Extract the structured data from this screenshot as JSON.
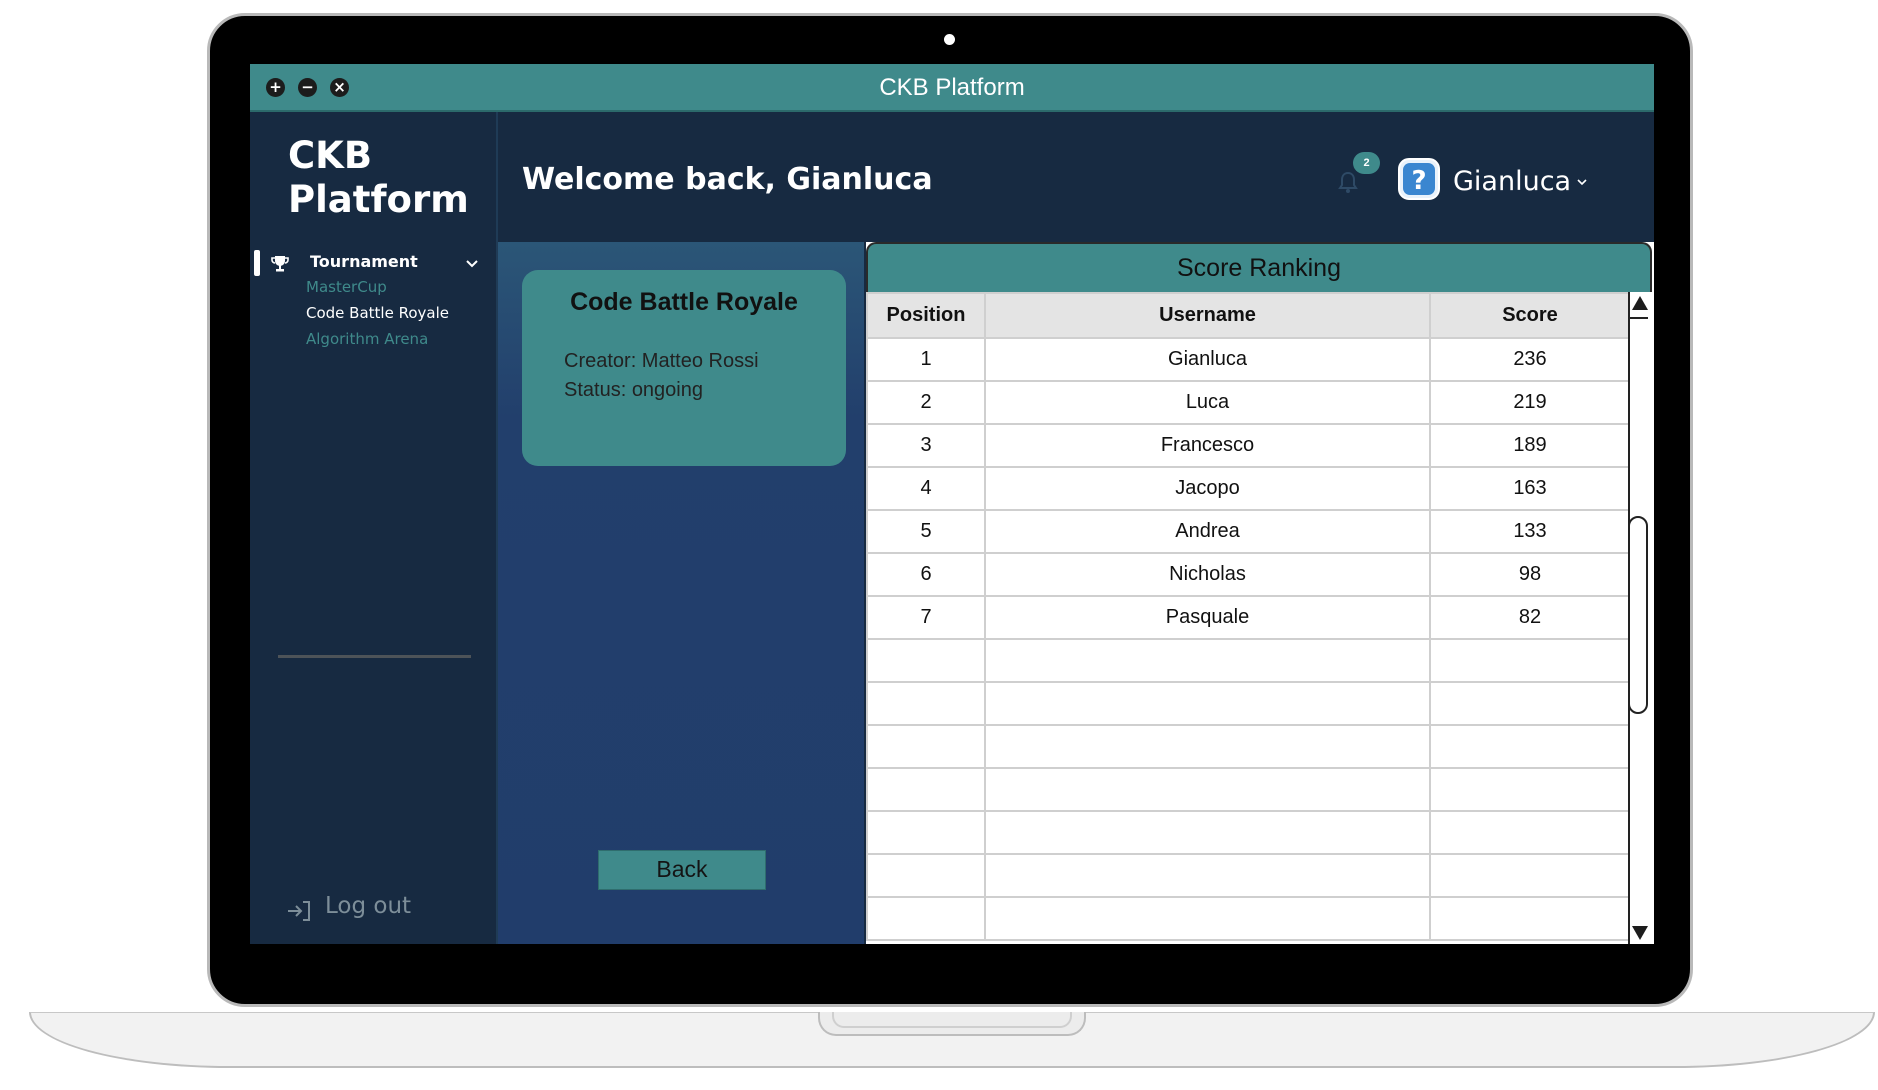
{
  "window": {
    "title": "CKB Platform",
    "buttons": [
      "+",
      "−",
      "×"
    ]
  },
  "sidebar": {
    "brand_line1": "CKB",
    "brand_line2": "Platform",
    "section_label": "Tournament",
    "items": [
      {
        "label": "MasterCup",
        "active": false
      },
      {
        "label": "Code Battle Royale",
        "active": true
      },
      {
        "label": "Algorithm Arena",
        "active": false
      }
    ],
    "logout_label": "Log out"
  },
  "header": {
    "welcome": "Welcome back, Gianluca",
    "notification_count": "2",
    "username": "Gianluca",
    "avatar_glyph": "?"
  },
  "tournament_card": {
    "title": "Code Battle Royale",
    "creator": "Creator: Matteo Rossi",
    "status": "Status: ongoing"
  },
  "back_label": "Back",
  "ranking": {
    "title": "Score Ranking",
    "columns": [
      "Position",
      "Username",
      "Score"
    ],
    "rows": [
      [
        "1",
        "Gianluca",
        "236"
      ],
      [
        "2",
        "Luca",
        "219"
      ],
      [
        "3",
        "Francesco",
        "189"
      ],
      [
        "4",
        "Jacopo",
        "163"
      ],
      [
        "5",
        "Andrea",
        "133"
      ],
      [
        "6",
        "Nicholas",
        "98"
      ],
      [
        "7",
        "Pasquale",
        "82"
      ]
    ],
    "empty_rows": 7
  },
  "colors": {
    "accent": "#3f8a8b",
    "sidebar_bg": "#172a41",
    "content_bg": "#213d6b",
    "active_item": "#ffffff",
    "inactive_item": "#3f8a8b"
  }
}
